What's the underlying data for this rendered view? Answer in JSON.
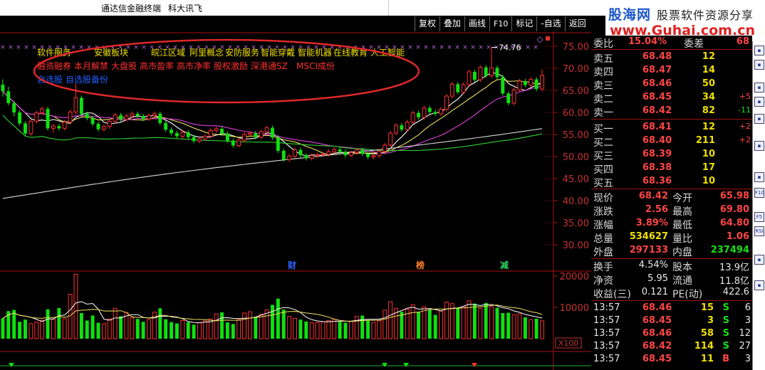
{
  "window": {
    "app_title": "通达信金融终端",
    "stock_name": "科大讯飞"
  },
  "watermark": {
    "brand": "股海网",
    "slogan": "股票软件资源分享",
    "url": "www.Guhai.com.cn"
  },
  "toolbar": {
    "buttons": [
      "复权",
      "叠加",
      "画线",
      "F10",
      "标记",
      "-自选",
      "返回"
    ]
  },
  "concepts": {
    "line1": [
      "软件服务",
      "安徽板块",
      "皖江区域",
      "阿里概念",
      "安防服务",
      "智能穿戴",
      "智能机器",
      "在线教育",
      "人工智能"
    ],
    "line2": [
      "融资融券",
      "本月解禁",
      "大盘股",
      "高市盈率",
      "高市净率",
      "股权激励",
      "深港通SZ",
      "MSCI成份"
    ],
    "line3": [
      "自选股",
      "自选股备份"
    ]
  },
  "price_axis": [
    "75.00",
    "70.00",
    "65.00",
    "60.00",
    "55.00",
    "50.00",
    "45.00",
    "40.00",
    "35.00",
    "30.00"
  ],
  "volume_axis": [
    "20000",
    "10000",
    "X100"
  ],
  "chart_data": {
    "type": "candlestick",
    "peak_label": "74.76",
    "event_markers": [
      "财",
      "榜",
      "减"
    ],
    "candles": [
      [
        66.3,
        64.8,
        67.5,
        63.6
      ],
      [
        64.8,
        62.1,
        65.8,
        61.6
      ],
      [
        62.1,
        60.0,
        62.6,
        59.1
      ],
      [
        60.0,
        57.5,
        60.6,
        57.0
      ],
      [
        57.5,
        55.2,
        58.0,
        54.7
      ],
      [
        55.2,
        58.0,
        58.5,
        54.7
      ],
      [
        58.0,
        59.9,
        60.4,
        57.5
      ],
      [
        59.9,
        60.8,
        61.3,
        59.4
      ],
      [
        60.8,
        56.4,
        61.3,
        55.9
      ],
      [
        56.4,
        56.9,
        57.4,
        55.4
      ],
      [
        56.9,
        56.4,
        57.4,
        55.9
      ],
      [
        56.4,
        57.8,
        58.3,
        55.9
      ],
      [
        57.8,
        60.1,
        60.6,
        57.3
      ],
      [
        60.1,
        63.3,
        66.6,
        59.6
      ],
      [
        63.3,
        59.7,
        63.8,
        59.2
      ],
      [
        59.7,
        58.7,
        60.2,
        58.2
      ],
      [
        58.7,
        57.4,
        59.2,
        56.9
      ],
      [
        57.4,
        56.2,
        57.9,
        55.7
      ],
      [
        56.2,
        56.8,
        57.3,
        55.7
      ],
      [
        56.8,
        58.0,
        58.5,
        56.3
      ],
      [
        58.0,
        59.4,
        59.9,
        57.5
      ],
      [
        59.4,
        58.4,
        59.9,
        57.9
      ],
      [
        58.4,
        59.2,
        59.7,
        57.9
      ],
      [
        59.2,
        59.7,
        60.2,
        58.7
      ],
      [
        59.7,
        59.2,
        60.2,
        58.7
      ],
      [
        59.2,
        58.5,
        59.7,
        58.0
      ],
      [
        58.5,
        59.3,
        59.8,
        58.0
      ],
      [
        59.3,
        59.7,
        60.2,
        58.8
      ],
      [
        59.7,
        57.6,
        60.2,
        57.1
      ],
      [
        57.6,
        56.1,
        58.1,
        55.6
      ],
      [
        56.1,
        55.3,
        56.6,
        54.8
      ],
      [
        55.3,
        54.6,
        55.8,
        54.1
      ],
      [
        54.6,
        55.5,
        56.0,
        54.1
      ],
      [
        55.5,
        54.4,
        56.0,
        53.9
      ],
      [
        54.4,
        53.5,
        54.9,
        53.0
      ],
      [
        53.5,
        54.0,
        54.5,
        53.0
      ],
      [
        54.0,
        54.6,
        55.1,
        53.5
      ],
      [
        54.6,
        55.9,
        56.4,
        54.1
      ],
      [
        55.9,
        56.3,
        56.8,
        55.4
      ],
      [
        56.3,
        55.2,
        56.8,
        54.7
      ],
      [
        55.2,
        53.6,
        55.7,
        53.1
      ],
      [
        53.6,
        52.5,
        54.1,
        52.0
      ],
      [
        52.5,
        53.7,
        54.2,
        52.0
      ],
      [
        53.7,
        55.0,
        55.5,
        53.2
      ],
      [
        55.0,
        55.3,
        55.8,
        54.5
      ],
      [
        55.3,
        54.4,
        55.8,
        53.9
      ],
      [
        54.4,
        55.6,
        56.1,
        53.9
      ],
      [
        55.6,
        56.5,
        57.0,
        55.1
      ],
      [
        56.5,
        54.3,
        57.0,
        53.8
      ],
      [
        54.3,
        51.3,
        54.8,
        50.8
      ],
      [
        51.3,
        49.3,
        51.8,
        48.8
      ],
      [
        49.3,
        50.1,
        50.6,
        48.8
      ],
      [
        50.1,
        51.5,
        52.0,
        49.6
      ],
      [
        51.5,
        50.3,
        52.0,
        49.8
      ],
      [
        50.3,
        49.6,
        50.8,
        49.1
      ],
      [
        49.6,
        50.2,
        50.7,
        49.1
      ],
      [
        50.2,
        50.4,
        50.9,
        49.7
      ],
      [
        50.4,
        50.5,
        51.0,
        49.9
      ],
      [
        50.5,
        51.1,
        51.6,
        50.0
      ],
      [
        51.1,
        51.6,
        52.1,
        50.6
      ],
      [
        51.6,
        51.1,
        52.1,
        50.6
      ],
      [
        51.1,
        50.3,
        51.6,
        49.8
      ],
      [
        50.3,
        50.9,
        51.4,
        49.8
      ],
      [
        50.9,
        51.5,
        52.0,
        50.4
      ],
      [
        51.5,
        50.6,
        52.0,
        50.1
      ],
      [
        50.6,
        49.9,
        51.1,
        49.4
      ],
      [
        49.9,
        50.2,
        50.7,
        49.4
      ],
      [
        50.2,
        51.2,
        51.7,
        49.7
      ],
      [
        51.2,
        52.6,
        53.1,
        50.7
      ],
      [
        52.6,
        55.3,
        55.8,
        52.1
      ],
      [
        55.3,
        57.1,
        57.6,
        54.8
      ],
      [
        57.1,
        56.1,
        57.6,
        55.6
      ],
      [
        56.1,
        57.8,
        58.3,
        55.6
      ],
      [
        57.8,
        59.9,
        60.4,
        57.3
      ],
      [
        59.9,
        58.9,
        60.4,
        58.4
      ],
      [
        58.9,
        61.0,
        61.5,
        58.4
      ],
      [
        61.0,
        60.1,
        61.5,
        59.6
      ],
      [
        60.1,
        59.7,
        60.6,
        59.2
      ],
      [
        59.7,
        60.7,
        61.2,
        59.2
      ],
      [
        60.7,
        63.7,
        64.2,
        60.2
      ],
      [
        63.7,
        66.4,
        66.9,
        63.2
      ],
      [
        66.4,
        64.6,
        66.9,
        64.1
      ],
      [
        64.6,
        66.3,
        66.8,
        64.1
      ],
      [
        66.3,
        69.2,
        69.7,
        65.8
      ],
      [
        69.2,
        67.4,
        69.7,
        66.9
      ],
      [
        67.4,
        70.2,
        70.7,
        66.9
      ],
      [
        70.2,
        68.3,
        70.7,
        67.8
      ],
      [
        68.3,
        70.1,
        74.76,
        67.8
      ],
      [
        70.1,
        68.0,
        70.6,
        67.5
      ],
      [
        68.0,
        64.3,
        68.5,
        63.8
      ],
      [
        64.3,
        62.1,
        64.8,
        61.6
      ],
      [
        62.1,
        65.1,
        65.6,
        61.6
      ],
      [
        65.1,
        67.1,
        67.6,
        64.6
      ],
      [
        67.1,
        66.2,
        67.6,
        65.7
      ],
      [
        66.2,
        67.5,
        68.0,
        65.7
      ],
      [
        67.5,
        65.3,
        68.0,
        64.8
      ],
      [
        65.3,
        68.42,
        69.8,
        64.8
      ]
    ],
    "volumes": [
      6500,
      8800,
      9200,
      5400,
      6100,
      4800,
      5300,
      5900,
      9400,
      6200,
      9800,
      6400,
      14200,
      20600,
      8200,
      5800,
      7400,
      5100,
      4800,
      6300,
      9700,
      7200,
      8400,
      6800,
      6300,
      5400,
      6100,
      8500,
      9700,
      6200,
      5300,
      4900,
      5800,
      5300,
      4500,
      5100,
      5700,
      6300,
      7900,
      8400,
      5200,
      4700,
      6100,
      8200,
      8600,
      6900,
      7800,
      9200,
      10800,
      12800,
      9300,
      7100,
      6500,
      6100,
      5500,
      5100,
      5200,
      5400,
      5800,
      6200,
      5400,
      5100,
      5500,
      7100,
      7400,
      5800,
      5200,
      5700,
      9100,
      11800,
      9700,
      8600,
      9400,
      10900,
      8600,
      10200,
      9200,
      7600,
      8800,
      11700,
      11200,
      9800,
      10200,
      12100,
      11200,
      9700,
      11400,
      10200,
      9900,
      8200,
      8300,
      7700,
      7900,
      6800,
      6100,
      6400,
      5700
    ]
  },
  "quote": {
    "weibi_label": "委比",
    "weibi": "15.04%",
    "weicha_label": "委差",
    "weicha": "68",
    "asks": [
      {
        "label": "卖五",
        "price": "68.48",
        "vol": "12",
        "chg": ""
      },
      {
        "label": "卖四",
        "price": "68.47",
        "vol": "14",
        "chg": ""
      },
      {
        "label": "卖三",
        "price": "68.46",
        "vol": "50",
        "chg": ""
      },
      {
        "label": "卖二",
        "price": "68.45",
        "vol": "34",
        "chg": "+5"
      },
      {
        "label": "卖一",
        "price": "68.42",
        "vol": "82",
        "chg": "-11"
      }
    ],
    "bids": [
      {
        "label": "买一",
        "price": "68.41",
        "vol": "12",
        "chg": "+2"
      },
      {
        "label": "买二",
        "price": "68.40",
        "vol": "211",
        "chg": "+2"
      },
      {
        "label": "买三",
        "price": "68.39",
        "vol": "10",
        "chg": ""
      },
      {
        "label": "买四",
        "price": "68.38",
        "vol": "17",
        "chg": ""
      },
      {
        "label": "买五",
        "price": "68.36",
        "vol": "10",
        "chg": ""
      }
    ],
    "stats": [
      {
        "l1": "现价",
        "v1": "68.42",
        "c1": "red",
        "l2": "今开",
        "v2": "65.98",
        "c2": "red"
      },
      {
        "l1": "涨跌",
        "v1": "2.56",
        "c1": "red",
        "l2": "最高",
        "v2": "69.80",
        "c2": "red"
      },
      {
        "l1": "涨幅",
        "v1": "3.89%",
        "c1": "red",
        "l2": "最低",
        "v2": "64.80",
        "c2": "red"
      },
      {
        "l1": "总量",
        "v1": "534627",
        "c1": "yel",
        "l2": "量比",
        "v2": "1.06",
        "c2": "red"
      },
      {
        "l1": "外盘",
        "v1": "297133",
        "c1": "red",
        "l2": "内盘",
        "v2": "237494",
        "c2": "grn"
      }
    ],
    "fund": [
      {
        "l1": "换手",
        "v1": "4.54%",
        "l2": "股本",
        "v2": "13.9亿"
      },
      {
        "l1": "净资",
        "v1": "5.95",
        "l2": "流通",
        "v2": "11.8亿"
      },
      {
        "l1": "收益(三)",
        "v1": "0.121",
        "l2": "PE(动)",
        "v2": "422.6"
      }
    ],
    "ticks": [
      {
        "time": "13:57",
        "price": "68.46",
        "vol": "15",
        "side": "S",
        "num": "6"
      },
      {
        "time": "13:57",
        "price": "68.45",
        "vol": "3",
        "side": "S",
        "num": "3"
      },
      {
        "time": "13:57",
        "price": "68.46",
        "vol": "58",
        "side": "S",
        "num": "12"
      },
      {
        "time": "13:57",
        "price": "68.42",
        "vol": "114",
        "side": "S",
        "num": "27"
      },
      {
        "time": "13:57",
        "price": "68.45",
        "vol": "11",
        "side": "B",
        "num": "3"
      }
    ]
  },
  "sidebar": {
    "icons": [
      "chart-icon",
      "list-icon",
      "sort-icon",
      "candle-icon",
      "info-icon",
      "news-icon",
      "settings-icon",
      "F10",
      "F5",
      "RSI",
      "arrow-icon",
      "zoom-icon"
    ],
    "texts": [
      "F10",
      "F5",
      "RSI"
    ]
  }
}
